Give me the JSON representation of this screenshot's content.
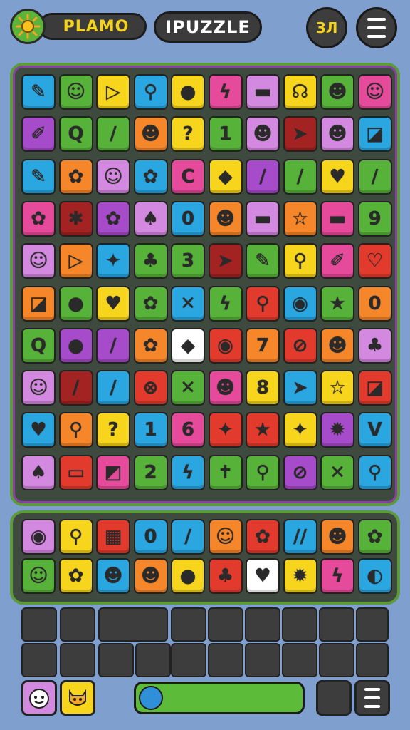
{
  "header": {
    "brand": "PLAMO",
    "title": "IPUZZLE",
    "coins_label": "ЗЛ",
    "icons": [
      "sun-icon",
      "menu-icon"
    ]
  },
  "colors": {
    "cyan": "#2aa6e0",
    "green": "#57b23a",
    "yellow": "#f7d51c",
    "orange": "#f5862a",
    "purple": "#a64bc9",
    "pink": "#e64a9a",
    "red": "#e23b2e",
    "darkred": "#a32323",
    "lilac": "#d489e0"
  },
  "board": {
    "rows": [
      [
        [
          "cyan",
          "✎"
        ],
        [
          "green",
          "☺"
        ],
        [
          "yellow",
          "▷"
        ],
        [
          "cyan",
          "⚲"
        ],
        [
          "yellow",
          "●"
        ],
        [
          "pink",
          "ϟ"
        ],
        [
          "lilac",
          "▬"
        ],
        [
          "yellow",
          "☊"
        ],
        [
          "green",
          "☻"
        ],
        [
          "pink",
          "☺"
        ]
      ],
      [
        [
          "purple",
          "✐"
        ],
        [
          "green",
          "Q"
        ],
        [
          "green",
          "/"
        ],
        [
          "orange",
          "☻"
        ],
        [
          "yellow",
          "?"
        ],
        [
          "green",
          "1"
        ],
        [
          "lilac",
          "☻"
        ],
        [
          "darkred",
          "➤"
        ],
        [
          "lilac",
          "☻"
        ],
        [
          "cyan",
          "◪"
        ]
      ],
      [
        [
          "cyan",
          "✎"
        ],
        [
          "orange",
          "✿"
        ],
        [
          "lilac",
          "☺"
        ],
        [
          "cyan",
          "✿"
        ],
        [
          "pink",
          "C"
        ],
        [
          "yellow",
          "◆"
        ],
        [
          "purple",
          "/"
        ],
        [
          "green",
          "/"
        ],
        [
          "yellow",
          "♥"
        ],
        [
          "green",
          "/"
        ]
      ],
      [
        [
          "pink",
          "✿"
        ],
        [
          "darkred",
          "✱"
        ],
        [
          "purple",
          "✿"
        ],
        [
          "lilac",
          "♠"
        ],
        [
          "cyan",
          "0"
        ],
        [
          "orange",
          "☻"
        ],
        [
          "lilac",
          "▬"
        ],
        [
          "orange",
          "☆"
        ],
        [
          "pink",
          "▬"
        ],
        [
          "green",
          "9"
        ]
      ],
      [
        [
          "lilac",
          "☺"
        ],
        [
          "orange",
          "▷"
        ],
        [
          "cyan",
          "✦"
        ],
        [
          "green",
          "♣"
        ],
        [
          "green",
          "3"
        ],
        [
          "darkred",
          "➤"
        ],
        [
          "green",
          "✎"
        ],
        [
          "yellow",
          "⚲"
        ],
        [
          "pink",
          "✐"
        ],
        [
          "red",
          "♡"
        ]
      ],
      [
        [
          "orange",
          "◪"
        ],
        [
          "green",
          "●"
        ],
        [
          "yellow",
          "♥"
        ],
        [
          "green",
          "✿"
        ],
        [
          "cyan",
          "✕"
        ],
        [
          "green",
          "ϟ"
        ],
        [
          "red",
          "⚲"
        ],
        [
          "cyan",
          "◉"
        ],
        [
          "green",
          "★"
        ],
        [
          "orange",
          "0"
        ]
      ],
      [
        [
          "green",
          "Q"
        ],
        [
          "purple",
          "●"
        ],
        [
          "purple",
          "/"
        ],
        [
          "orange",
          "✿"
        ],
        [
          "white",
          "◆"
        ],
        [
          "red",
          "◉"
        ],
        [
          "orange",
          "7"
        ],
        [
          "red",
          "⊘"
        ],
        [
          "orange",
          "☻"
        ],
        [
          "lilac",
          "♣"
        ]
      ],
      [
        [
          "lilac",
          "☺"
        ],
        [
          "darkred",
          "/"
        ],
        [
          "cyan",
          "/"
        ],
        [
          "red",
          "⊗"
        ],
        [
          "green",
          "✕"
        ],
        [
          "pink",
          "☻"
        ],
        [
          "yellow",
          "8"
        ],
        [
          "cyan",
          "➤"
        ],
        [
          "yellow",
          "☆"
        ],
        [
          "red",
          "◪"
        ]
      ],
      [
        [
          "cyan",
          "♥"
        ],
        [
          "orange",
          "⚲"
        ],
        [
          "yellow",
          "?"
        ],
        [
          "cyan",
          "1"
        ],
        [
          "pink",
          "6"
        ],
        [
          "red",
          "✦"
        ],
        [
          "red",
          "★"
        ],
        [
          "yellow",
          "✦"
        ],
        [
          "purple",
          "✹"
        ],
        [
          "cyan",
          "V"
        ]
      ],
      [
        [
          "lilac",
          "♠"
        ],
        [
          "red",
          "▭"
        ],
        [
          "pink",
          "◩"
        ],
        [
          "green",
          "2"
        ],
        [
          "cyan",
          "ϟ"
        ],
        [
          "green",
          "✝"
        ],
        [
          "green",
          "⚲"
        ],
        [
          "purple",
          "⊘"
        ],
        [
          "green",
          "✕"
        ],
        [
          "cyan",
          "⚲"
        ]
      ]
    ]
  },
  "tray": {
    "rows": [
      [
        [
          "lilac",
          "◉"
        ],
        [
          "yellow",
          "⚲"
        ],
        [
          "red",
          "▦"
        ],
        [
          "cyan",
          "0"
        ],
        [
          "cyan",
          "/"
        ],
        [
          "orange",
          "☺"
        ],
        [
          "red",
          "✿"
        ],
        [
          "cyan",
          "//"
        ],
        [
          "orange",
          "☻"
        ],
        [
          "green",
          "✿"
        ]
      ],
      [
        [
          "green",
          "☺"
        ],
        [
          "yellow",
          "✿"
        ],
        [
          "cyan",
          "☻"
        ],
        [
          "orange",
          "☻"
        ],
        [
          "yellow",
          "●"
        ],
        [
          "red",
          "♣"
        ],
        [
          "white",
          "♥"
        ],
        [
          "yellow",
          "✹"
        ],
        [
          "pink",
          "ϟ"
        ],
        [
          "cyan",
          "◐"
        ]
      ]
    ]
  },
  "progress": {
    "value": 1.0
  }
}
